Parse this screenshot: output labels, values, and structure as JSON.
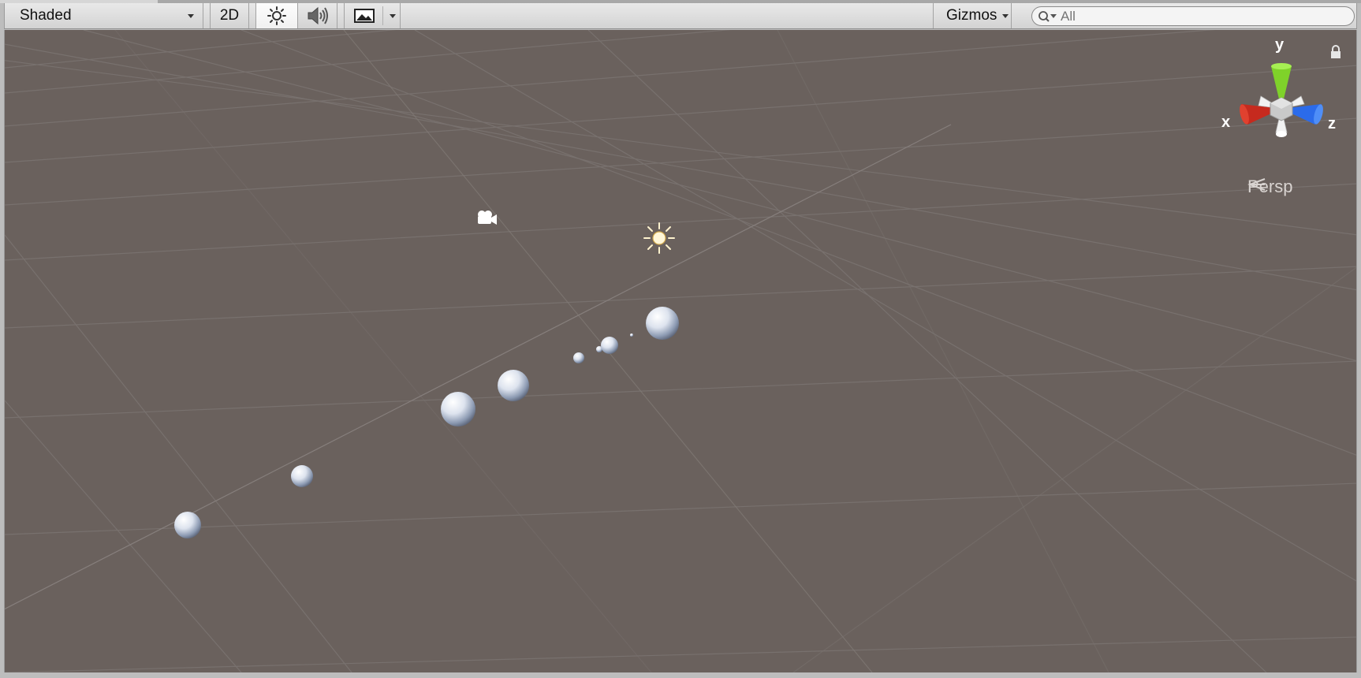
{
  "toolbar": {
    "shading_mode": "Shaded",
    "mode_2d": "2D",
    "lighting_icon": "sun-icon",
    "audio_icon": "speaker-icon",
    "effects_icon": "image-icon",
    "gizmos_label": "Gizmos",
    "search_placeholder": "All"
  },
  "scene": {
    "camera_icon": "camera-icon",
    "light_icon": "directional-light-icon",
    "background_color": "#6a615d",
    "grid_color": "#7b7470",
    "sphere_count": 9
  },
  "gizmo": {
    "x_label": "x",
    "y_label": "y",
    "z_label": "z",
    "projection": "Persp",
    "x_color": "#c62a1e",
    "y_color": "#7fd22a",
    "z_color": "#2b6bea",
    "lock_icon": "lock-icon"
  }
}
